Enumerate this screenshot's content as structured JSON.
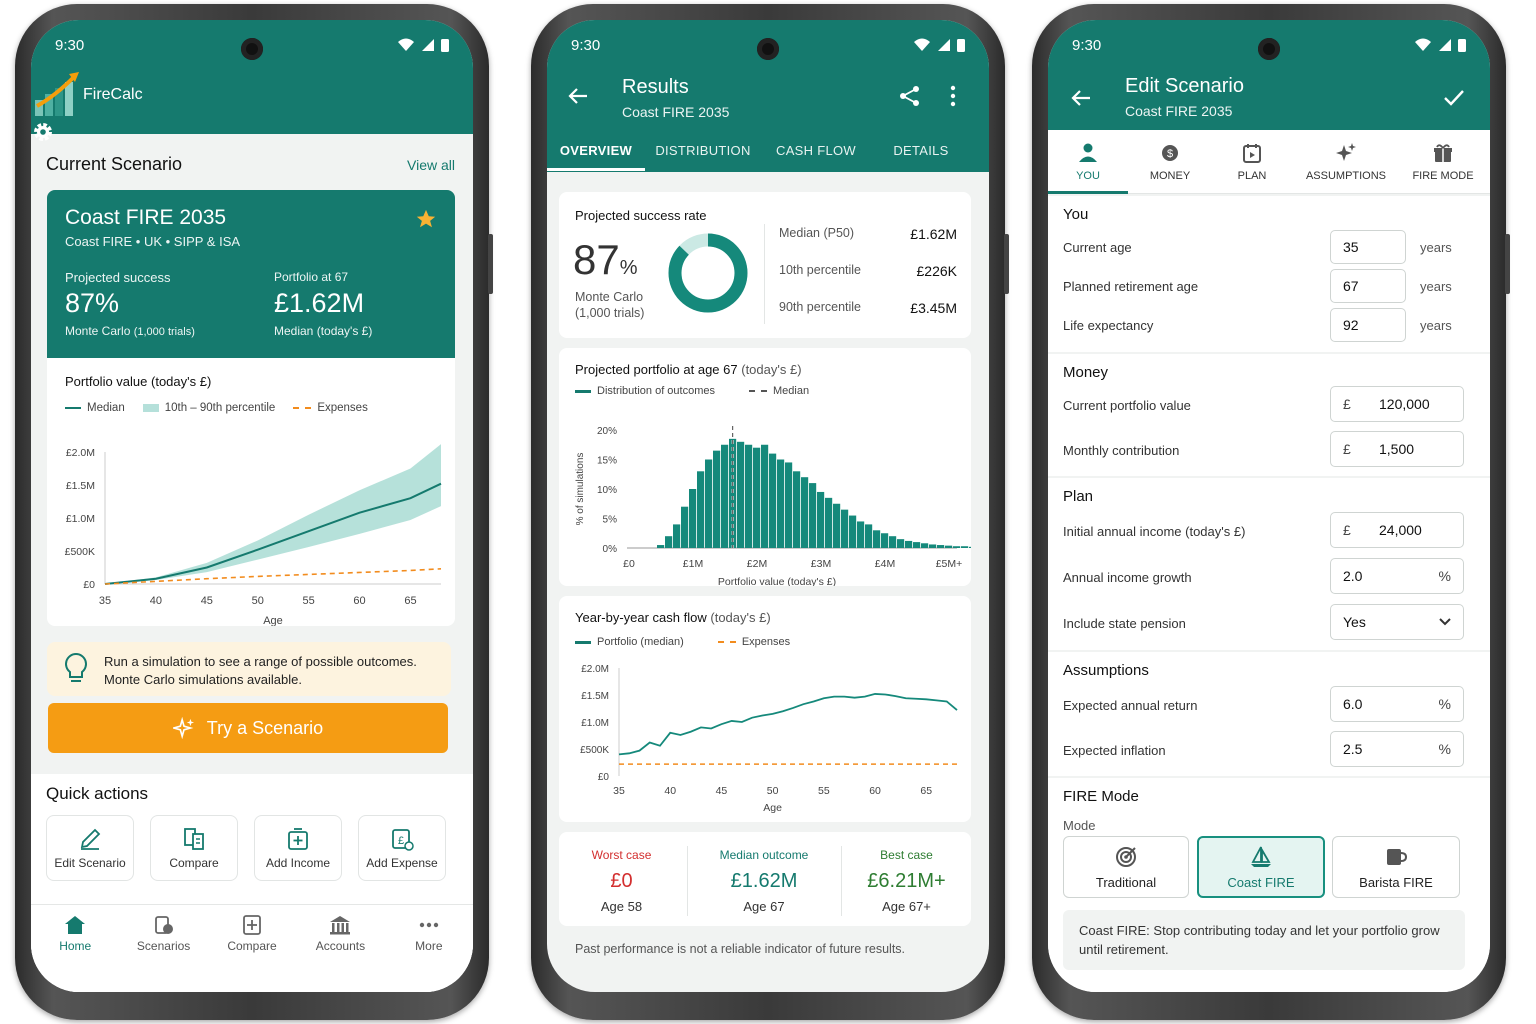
{
  "status": {
    "time": "9:30"
  },
  "screen1": {
    "app_title": "FireCalc",
    "section_title": "Current Scenario",
    "view_all": "View all",
    "scenario": {
      "name": "Coast FIRE 2035",
      "subtitle": "Coast FIRE • UK • SIPP & ISA",
      "success_label": "Projected success",
      "success_value": "87%",
      "success_note": "Monte Carlo",
      "success_note_small": "(1,000 trials)",
      "portfolio_label": "Portfolio at 67",
      "portfolio_value": "£1.62M",
      "portfolio_note": "Median (today's £)"
    },
    "chart_title": "Portfolio value",
    "chart_title_unit": "(today's £)",
    "legend": [
      "Median",
      "10th – 90th percentile",
      "Expenses"
    ],
    "tip_line1": "Run a simulation to see a range of possible outcomes.",
    "tip_line2": "Monte Carlo simulations available.",
    "cta": "Try a Scenario",
    "quick_title": "Quick actions",
    "quick": [
      "Edit Scenario",
      "Compare",
      "Add Income",
      "Add Expense"
    ],
    "nav": [
      "Home",
      "Scenarios",
      "Compare",
      "Accounts",
      "More"
    ]
  },
  "screen2": {
    "title": "Results",
    "subtitle": "Coast FIRE 2035",
    "tabs": [
      "OVERVIEW",
      "DISTRIBUTION",
      "CASH FLOW",
      "DETAILS"
    ],
    "success_label": "Projected success rate",
    "success_value": "87",
    "success_unit": "%",
    "success_note1": "Monte Carlo",
    "success_note2": "(1,000 trials)",
    "stats": [
      {
        "label": "Median (P50)",
        "value": "£1.62M"
      },
      {
        "label": "10th percentile",
        "value": "£226K"
      },
      {
        "label": "90th percentile",
        "value": "£3.45M"
      }
    ],
    "hist_title": "Projected portfolio at age 67",
    "hist_title_unit": "(today's £)",
    "hist_legend": [
      "Distribution of outcomes",
      "Median"
    ],
    "cash_title": "Year-by-year cash flow",
    "cash_title_unit": "(today's £)",
    "cash_legend": [
      "Portfolio (median)",
      "Expenses"
    ],
    "outcomes": [
      {
        "label": "Worst case",
        "value": "£0",
        "age": "Age 58",
        "color": "#d32f2f"
      },
      {
        "label": "Median outcome",
        "value": "£1.62M",
        "age": "Age 67",
        "color": "#157a6e"
      },
      {
        "label": "Best case",
        "value": "£6.21M+",
        "age": "Age 67+",
        "color": "#2e7d32"
      }
    ],
    "disclaimer": "Past performance is not a reliable indicator of future results."
  },
  "screen3": {
    "title": "Edit Scenario",
    "subtitle": "Coast FIRE 2035",
    "tabs": [
      "YOU",
      "MONEY",
      "PLAN",
      "ASSUMPTIONS",
      "FIRE MODE"
    ],
    "you_title": "You",
    "you": [
      {
        "label": "Current age",
        "value": "35",
        "unit": "years"
      },
      {
        "label": "Planned retirement age",
        "value": "67",
        "unit": "years"
      },
      {
        "label": "Life expectancy",
        "value": "92",
        "unit": "years"
      }
    ],
    "money_title": "Money",
    "money": [
      {
        "label": "Current portfolio value",
        "prefix": "£",
        "value": "120,000"
      },
      {
        "label": "Monthly contribution",
        "prefix": "£",
        "value": "1,500"
      }
    ],
    "plan_title": "Plan",
    "plan": [
      {
        "label": "Initial annual income (today's £)",
        "prefix": "£",
        "value": "24,000"
      },
      {
        "label": "Annual income growth",
        "value": "2.0",
        "suffix": "%"
      },
      {
        "label": "Include state pension",
        "value": "Yes"
      }
    ],
    "assumptions_title": "Assumptions",
    "assumptions": [
      {
        "label": "Expected annual return",
        "value": "6.0",
        "suffix": "%"
      },
      {
        "label": "Expected inflation",
        "value": "2.5",
        "suffix": "%"
      }
    ],
    "fire_title": "FIRE Mode",
    "mode_label": "Mode",
    "modes": [
      "Traditional",
      "Coast FIRE",
      "Barista FIRE"
    ],
    "mode_note": "Coast FIRE: Stop contributing today and let your portfolio grow until retirement."
  },
  "chart_data": [
    {
      "type": "area",
      "title": "Portfolio value (today's £)",
      "xlabel": "Age",
      "ylabel": "",
      "x": [
        35,
        40,
        45,
        50,
        55,
        60,
        65,
        68
      ],
      "xticks": [
        "35",
        "40",
        "45",
        "50",
        "55",
        "60",
        "65"
      ],
      "yticks": [
        "£0",
        "£500K",
        "£1.0M",
        "£1.5M",
        "£2.0M"
      ],
      "ylim": [
        0,
        2000000
      ],
      "series": [
        {
          "name": "Median",
          "values": [
            0,
            80000,
            250000,
            520000,
            800000,
            1080000,
            1300000,
            1520000
          ]
        },
        {
          "name": "10th – 90th percentile (low)",
          "values": [
            0,
            60000,
            180000,
            370000,
            560000,
            760000,
            970000,
            1180000
          ]
        },
        {
          "name": "10th – 90th percentile (high)",
          "values": [
            0,
            100000,
            320000,
            660000,
            1050000,
            1420000,
            1750000,
            2120000
          ]
        },
        {
          "name": "Expenses",
          "values": [
            0,
            40000,
            80000,
            115000,
            145000,
            175000,
            205000,
            230000
          ]
        }
      ]
    },
    {
      "type": "bar",
      "title": "Projected portfolio at age 67 (today's £)",
      "xlabel": "Portfolio value (today's £)",
      "ylabel": "% of simulations",
      "xticks": [
        "£0",
        "£1M",
        "£2M",
        "£3M",
        "£4M",
        "£5M+"
      ],
      "yticks": [
        "0%",
        "5%",
        "10%",
        "15%",
        "20%"
      ],
      "ylim": [
        0,
        20
      ],
      "median": 1.62,
      "values": [
        0.5,
        2,
        4,
        7,
        10,
        13,
        15,
        16.5,
        17.5,
        18.5,
        18,
        17.5,
        17,
        17.5,
        16,
        15,
        14.5,
        13,
        12,
        11,
        9.5,
        8.5,
        7.5,
        6.5,
        5.5,
        4.5,
        4,
        3,
        2.5,
        2,
        1.5,
        1.2,
        1,
        0.8,
        0.6,
        0.5,
        0.4,
        0.3,
        0.3,
        0.2
      ]
    },
    {
      "type": "line",
      "title": "Year-by-year cash flow (today's £)",
      "xlabel": "Age",
      "ylabel": "",
      "xticks": [
        "35",
        "40",
        "45",
        "50",
        "55",
        "60",
        "65"
      ],
      "yticks": [
        "£0",
        "£500K",
        "£1.0M",
        "£1.5M",
        "£2.0M"
      ],
      "ylim": [
        0,
        2000000
      ],
      "series": [
        {
          "name": "Portfolio (median)",
          "x": [
            35,
            36,
            37,
            38,
            39,
            40,
            41,
            42,
            43,
            44,
            45,
            46,
            47,
            48,
            49,
            50,
            51,
            52,
            53,
            54,
            55,
            56,
            57,
            58,
            59,
            60,
            61,
            62,
            63,
            64,
            65,
            66,
            67,
            68
          ],
          "values": [
            400000,
            420000,
            470000,
            620000,
            560000,
            800000,
            760000,
            820000,
            900000,
            880000,
            960000,
            1020000,
            1000000,
            1080000,
            1120000,
            1150000,
            1200000,
            1260000,
            1330000,
            1380000,
            1440000,
            1470000,
            1470000,
            1450000,
            1470000,
            1520000,
            1510000,
            1480000,
            1440000,
            1430000,
            1420000,
            1400000,
            1380000,
            1220000
          ]
        },
        {
          "name": "Expenses",
          "x": [
            35,
            68
          ],
          "values": [
            220000,
            220000
          ]
        }
      ]
    }
  ]
}
